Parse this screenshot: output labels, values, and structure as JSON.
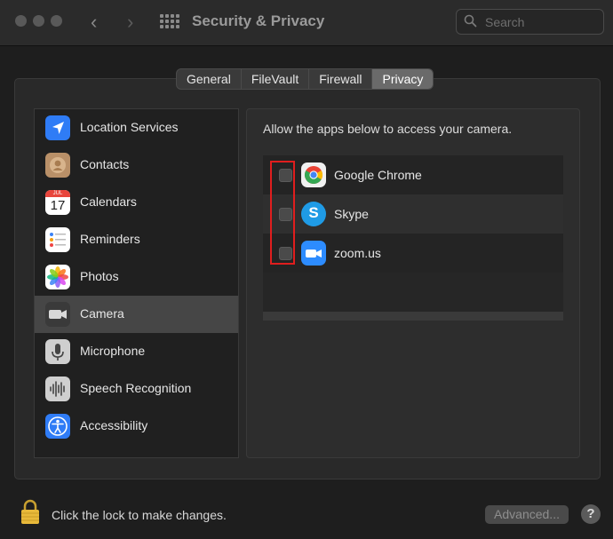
{
  "window": {
    "title": "Security & Privacy",
    "search_placeholder": "Search"
  },
  "tabs": [
    {
      "label": "General"
    },
    {
      "label": "FileVault"
    },
    {
      "label": "Firewall"
    },
    {
      "label": "Privacy",
      "selected": true
    }
  ],
  "sidebar": {
    "items": [
      {
        "label": "Location Services",
        "icon": "location-arrow-icon"
      },
      {
        "label": "Contacts",
        "icon": "contacts-icon"
      },
      {
        "label": "Calendars",
        "icon": "calendar-icon",
        "icon_month": "JUL",
        "icon_day": "17"
      },
      {
        "label": "Reminders",
        "icon": "reminders-icon"
      },
      {
        "label": "Photos",
        "icon": "photos-icon"
      },
      {
        "label": "Camera",
        "icon": "camera-icon",
        "selected": true
      },
      {
        "label": "Microphone",
        "icon": "microphone-icon"
      },
      {
        "label": "Speech Recognition",
        "icon": "speech-recognition-icon"
      },
      {
        "label": "Accessibility",
        "icon": "accessibility-icon"
      }
    ]
  },
  "content": {
    "prompt": "Allow the apps below to access your camera.",
    "apps": [
      {
        "label": "Google Chrome",
        "icon": "chrome-icon",
        "checked": false
      },
      {
        "label": "Skype",
        "icon": "skype-icon",
        "checked": false
      },
      {
        "label": "zoom.us",
        "icon": "zoom-icon",
        "checked": false
      }
    ]
  },
  "footer": {
    "lock_text": "Click the lock to make changes.",
    "advanced_label": "Advanced...",
    "help_label": "?"
  },
  "colors": {
    "highlight": "#e01e1e",
    "selected_row": "#464646",
    "background": "#1e1e1e"
  }
}
